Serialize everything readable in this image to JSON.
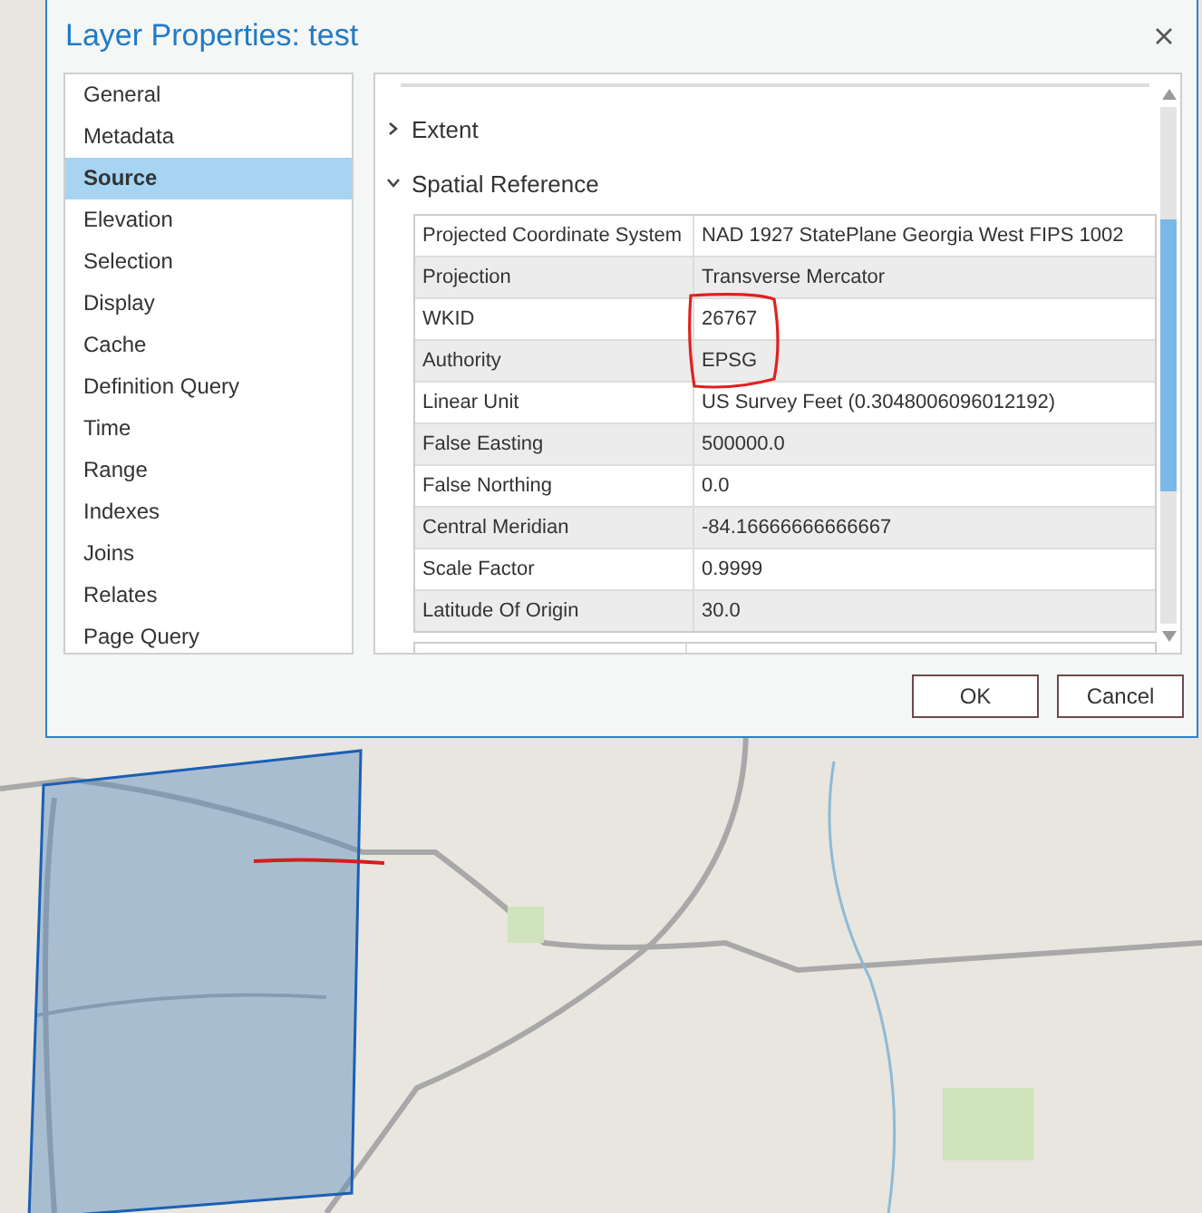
{
  "window": {
    "title": "Layer Properties: test"
  },
  "sidebar": {
    "items": [
      {
        "label": "General",
        "selected": false
      },
      {
        "label": "Metadata",
        "selected": false
      },
      {
        "label": "Source",
        "selected": true
      },
      {
        "label": "Elevation",
        "selected": false
      },
      {
        "label": "Selection",
        "selected": false
      },
      {
        "label": "Display",
        "selected": false
      },
      {
        "label": "Cache",
        "selected": false
      },
      {
        "label": "Definition Query",
        "selected": false
      },
      {
        "label": "Time",
        "selected": false
      },
      {
        "label": "Range",
        "selected": false
      },
      {
        "label": "Indexes",
        "selected": false
      },
      {
        "label": "Joins",
        "selected": false
      },
      {
        "label": "Relates",
        "selected": false
      },
      {
        "label": "Page Query",
        "selected": false
      }
    ]
  },
  "sections": [
    {
      "title": "Extent",
      "expanded": false
    },
    {
      "title": "Spatial Reference",
      "expanded": true,
      "rows": [
        {
          "label": "Projected Coordinate System",
          "value": "NAD 1927 StatePlane Georgia West FIPS 1002"
        },
        {
          "label": "Projection",
          "value": "Transverse Mercator"
        },
        {
          "label": "WKID",
          "value": "26767"
        },
        {
          "label": "Authority",
          "value": "EPSG"
        },
        {
          "label": "Linear Unit",
          "value": "US Survey Feet (0.3048006096012192)"
        },
        {
          "label": "False Easting",
          "value": "500000.0"
        },
        {
          "label": "False Northing",
          "value": "0.0"
        },
        {
          "label": "Central Meridian",
          "value": "-84.16666666666667"
        },
        {
          "label": "Scale Factor",
          "value": "0.9999"
        },
        {
          "label": "Latitude Of Origin",
          "value": "30.0"
        }
      ]
    }
  ],
  "buttons": [
    "OK",
    "Cancel"
  ]
}
